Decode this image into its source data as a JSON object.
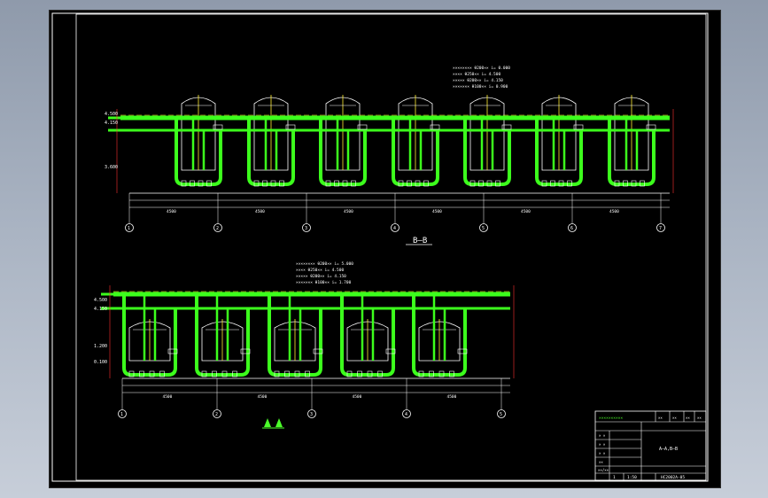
{
  "drawing": {
    "section_label": "B—B",
    "upper_grid_markers": [
      "1",
      "2",
      "3",
      "4",
      "5",
      "6",
      "7"
    ],
    "lower_grid_markers": [
      "1",
      "2",
      "3",
      "4",
      "5"
    ],
    "upper_notes": [
      "××××××××  θ200×× i= 0.000",
      "××××  θ250×× i= 4.500",
      "×××××  θ200×× i= 4.150",
      "×××××××  θ100×× i= 0.900"
    ],
    "lower_notes": [
      "××××××××  θ200×× i= 5.000",
      "××××  θ250×× i= 4.500",
      "×××××  θ200×× i= 4.150",
      "×××××××  θ100×× i= 1.700"
    ],
    "elevations_left_upper": [
      "4.500",
      "4.150",
      "3.600"
    ],
    "elevations_left_lower": [
      "4.500",
      "4.150",
      "1.200",
      "0.100"
    ],
    "dims_upper": [
      "4500",
      "4500",
      "4500",
      "4500",
      "4500",
      "4500"
    ],
    "dims_lower": [
      "4500",
      "4500",
      "4500",
      "4500"
    ]
  },
  "title_block": {
    "company": "××××××××××",
    "drawing_name": "A—A,B—B",
    "scale": "1:50",
    "drawing_no": "HC2002A-05",
    "sheet": "1",
    "cols": [
      "××",
      "××",
      "××",
      "××",
      "×"
    ],
    "roles": [
      "× ×",
      "× ×",
      "× ×",
      "××",
      "××/××"
    ]
  }
}
